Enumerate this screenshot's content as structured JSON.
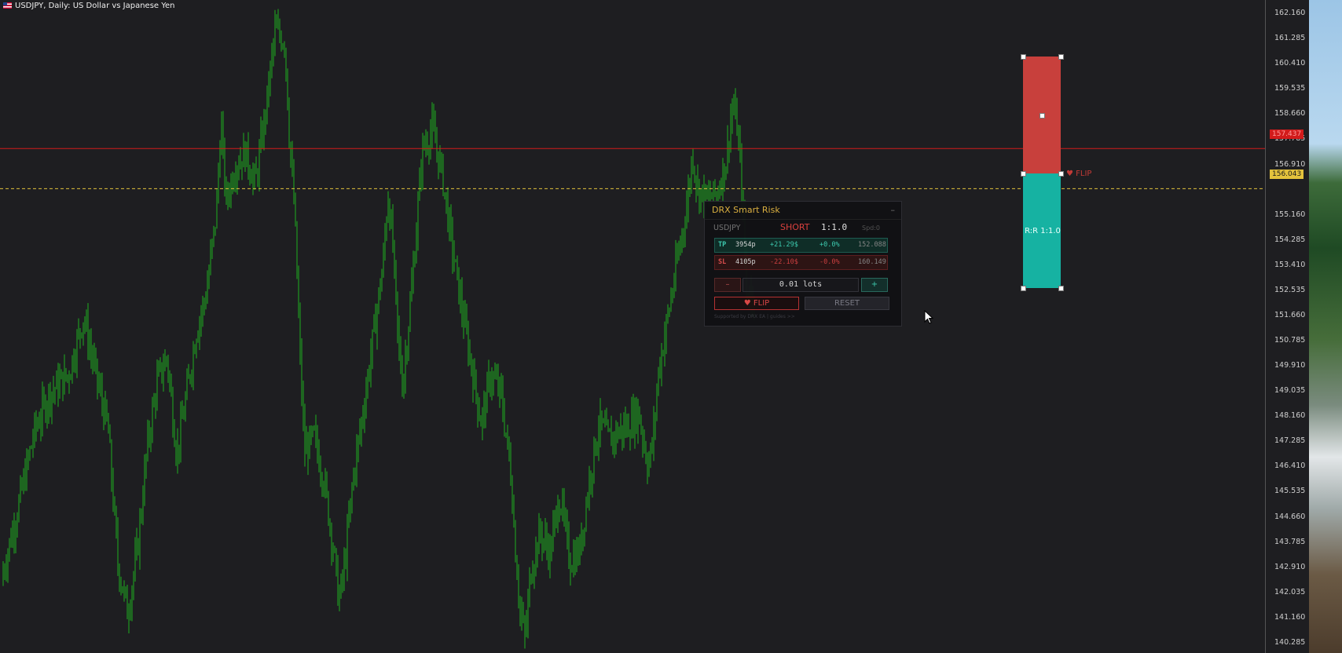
{
  "window": {
    "title": "USDJPY, Daily:  US Dollar vs Japanese Yen"
  },
  "price_axis": {
    "ticks": [
      "162.160",
      "161.285",
      "160.410",
      "159.535",
      "158.660",
      "157.785",
      "156.910",
      "155.160",
      "154.285",
      "153.410",
      "152.535",
      "151.660",
      "150.785",
      "149.910",
      "149.035",
      "148.160",
      "147.285",
      "146.410",
      "145.535",
      "144.660",
      "143.785",
      "142.910",
      "142.035",
      "141.160",
      "140.285"
    ],
    "red_tag": "157.437",
    "yellow_tag": "156.043"
  },
  "chart_data": {
    "type": "ohlc",
    "symbol": "USDJPY",
    "timeframe": "Daily",
    "ylim": [
      139.9,
      162.6
    ],
    "series_color": "#1fae1f",
    "approx_close_path": [
      [
        0,
        142.3
      ],
      [
        0.02,
        145.2
      ],
      [
        0.035,
        147.6
      ],
      [
        0.05,
        148.9
      ],
      [
        0.07,
        149.6
      ],
      [
        0.085,
        151.6
      ],
      [
        0.095,
        150.0
      ],
      [
        0.11,
        147.7
      ],
      [
        0.12,
        143.0
      ],
      [
        0.13,
        141.3
      ],
      [
        0.14,
        143.5
      ],
      [
        0.15,
        147.1
      ],
      [
        0.16,
        149.3
      ],
      [
        0.17,
        150.2
      ],
      [
        0.18,
        146.8
      ],
      [
        0.19,
        148.9
      ],
      [
        0.2,
        151.1
      ],
      [
        0.21,
        152.4
      ],
      [
        0.22,
        155.1
      ],
      [
        0.225,
        158.4
      ],
      [
        0.23,
        155.6
      ],
      [
        0.24,
        156.9
      ],
      [
        0.25,
        157.3
      ],
      [
        0.26,
        156.2
      ],
      [
        0.27,
        158.6
      ],
      [
        0.28,
        161.5
      ],
      [
        0.29,
        161.2
      ],
      [
        0.295,
        157.6
      ],
      [
        0.3,
        155.2
      ],
      [
        0.305,
        150.6
      ],
      [
        0.31,
        146.9
      ],
      [
        0.32,
        147.4
      ],
      [
        0.33,
        145.9
      ],
      [
        0.34,
        143.4
      ],
      [
        0.345,
        141.7
      ],
      [
        0.35,
        142.7
      ],
      [
        0.36,
        146.1
      ],
      [
        0.37,
        148.4
      ],
      [
        0.38,
        150.9
      ],
      [
        0.39,
        153.4
      ],
      [
        0.395,
        155.9
      ],
      [
        0.4,
        154.0
      ],
      [
        0.405,
        150.9
      ],
      [
        0.41,
        149.2
      ],
      [
        0.42,
        152.9
      ],
      [
        0.43,
        157.4
      ],
      [
        0.44,
        158.1
      ],
      [
        0.45,
        156.6
      ],
      [
        0.46,
        154.1
      ],
      [
        0.47,
        151.9
      ],
      [
        0.48,
        149.9
      ],
      [
        0.49,
        147.9
      ],
      [
        0.5,
        149.6
      ],
      [
        0.51,
        148.9
      ],
      [
        0.52,
        146.2
      ],
      [
        0.525,
        143.4
      ],
      [
        0.53,
        141.2
      ],
      [
        0.535,
        140.4
      ],
      [
        0.54,
        142.7
      ],
      [
        0.55,
        144.1
      ],
      [
        0.56,
        143.4
      ],
      [
        0.57,
        145.4
      ],
      [
        0.58,
        143.1
      ],
      [
        0.59,
        143.4
      ],
      [
        0.6,
        145.9
      ],
      [
        0.61,
        147.9
      ],
      [
        0.62,
        147.3
      ],
      [
        0.63,
        147.6
      ],
      [
        0.64,
        147.8
      ],
      [
        0.65,
        148.3
      ],
      [
        0.66,
        146.4
      ],
      [
        0.665,
        147.3
      ],
      [
        0.67,
        149.6
      ],
      [
        0.68,
        151.6
      ],
      [
        0.69,
        153.6
      ],
      [
        0.7,
        155.6
      ],
      [
        0.705,
        157.3
      ],
      [
        0.71,
        156.1
      ],
      [
        0.72,
        155.6
      ],
      [
        0.73,
        155.9
      ],
      [
        0.74,
        157.1
      ],
      [
        0.745,
        158.9
      ],
      [
        0.75,
        158.4
      ],
      [
        0.755,
        156.2
      ],
      [
        0.76,
        152.4
      ]
    ],
    "horizontal_lines": [
      {
        "price": 157.437,
        "color": "#d21b1b",
        "style": "solid"
      },
      {
        "price": 156.043,
        "color": "#e3c23c",
        "style": "dashed"
      }
    ],
    "position_tool": {
      "entry": 156.043,
      "stop": 160.149,
      "target": 152.088,
      "rr_label": "R:R 1:1.0",
      "flip_marker": "♥ FLIP"
    }
  },
  "risk_panel": {
    "title": "DRX Smart Risk",
    "minimize": "–",
    "symbol": "USDJPY",
    "direction": "SHORT",
    "ratio": "1:1.0",
    "spread": "Spd:0",
    "tp": {
      "label": "TP",
      "pips": "3954p",
      "money": "+21.29$",
      "pct": "+0.0%",
      "price": "152.088"
    },
    "sl": {
      "label": "SL",
      "pips": "4105p",
      "money": "-22.10$",
      "pct": "-0.0%",
      "price": "160.149"
    },
    "minus": "–",
    "plus": "+",
    "lots": "0.01 lots",
    "flip": "♥ FLIP",
    "reset": "RESET",
    "footer": "Supported by DRX EA | guides >>"
  }
}
